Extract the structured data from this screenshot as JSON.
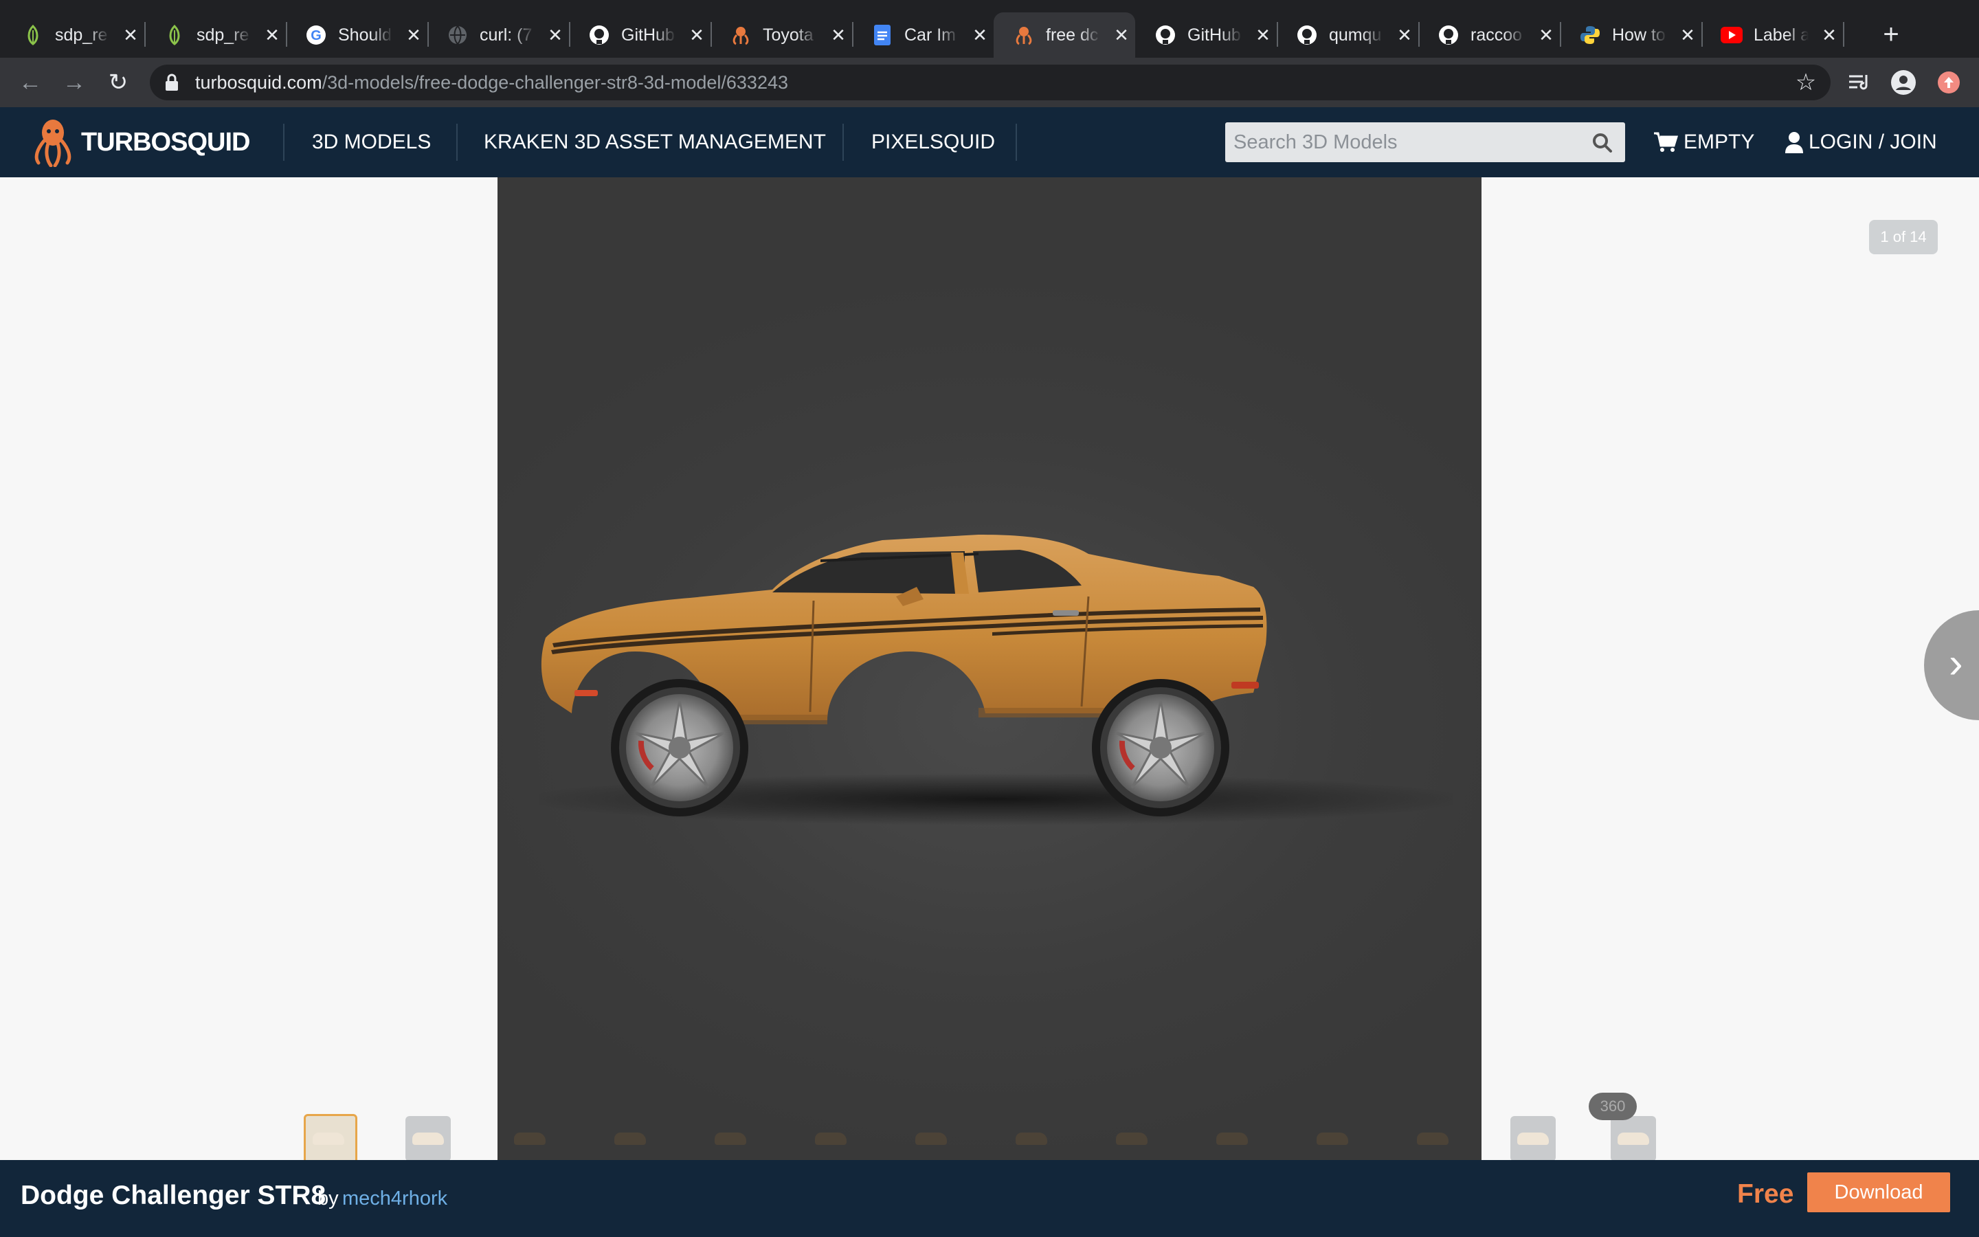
{
  "browser": {
    "tabs": [
      {
        "title": "sdp_re",
        "icon": "leaf-icon"
      },
      {
        "title": "sdp_re",
        "icon": "leaf-icon"
      },
      {
        "title": "Should",
        "icon": "google-icon"
      },
      {
        "title": "curl: (7",
        "icon": "globe-icon"
      },
      {
        "title": "GitHub",
        "icon": "github-icon"
      },
      {
        "title": "Toyota",
        "icon": "turbosquid-icon"
      },
      {
        "title": "Car Im",
        "icon": "docs-icon"
      },
      {
        "title": "free dc",
        "icon": "turbosquid-icon",
        "active": true
      },
      {
        "title": "GitHub",
        "icon": "github-icon"
      },
      {
        "title": "qumqu",
        "icon": "github-icon"
      },
      {
        "title": "raccoo",
        "icon": "github-icon"
      },
      {
        "title": "How to",
        "icon": "python-icon"
      },
      {
        "title": "Label a",
        "icon": "youtube-icon"
      }
    ],
    "url_host": "turbosquid.com",
    "url_path": "/3d-models/free-dodge-challenger-str8-3d-model/633243"
  },
  "site": {
    "logo": "TURBOSQUID",
    "nav": [
      "3D MODELS",
      "KRAKEN 3D ASSET MANAGEMENT",
      "PIXELSQUID"
    ],
    "search_placeholder": "Search 3D Models",
    "cart_label": "EMPTY",
    "login_label": "LOGIN / JOIN"
  },
  "viewer": {
    "counter": "1 of 14",
    "badge_360": "360",
    "thumbnail_count": 14,
    "selected_thumbnail": 1
  },
  "product": {
    "title": "Dodge Challenger STR8",
    "by": "by",
    "author": "mech4rhork",
    "price": "Free",
    "download_label": "Download"
  },
  "colors": {
    "header_bg": "#12263a",
    "accent_orange": "#f0834b",
    "car_body": "#c9893a",
    "viewer_bg": "#3e3e3e"
  }
}
